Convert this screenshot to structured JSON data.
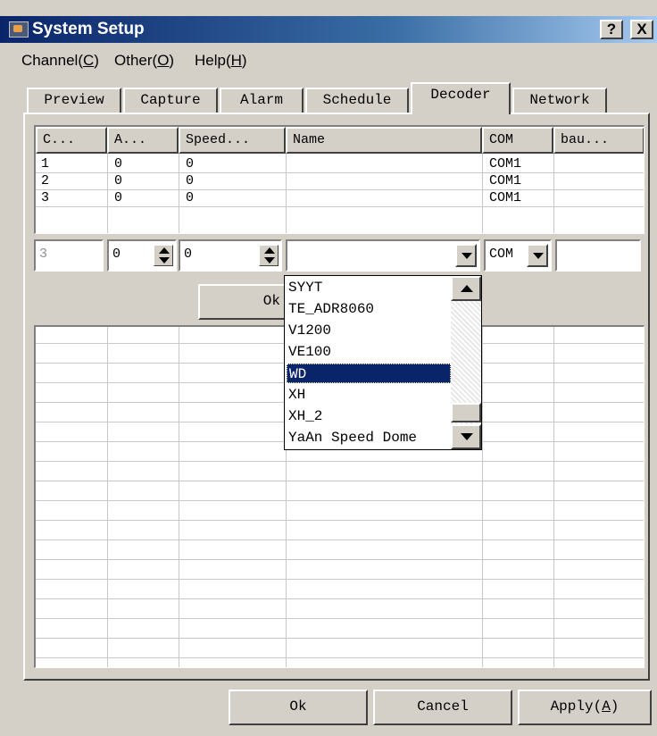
{
  "window": {
    "title": "System Setup",
    "help_btn": "?",
    "close_btn": "X"
  },
  "menu": [
    {
      "pre": "Channel(",
      "key": "C",
      "post": ")"
    },
    {
      "pre": "Other(",
      "key": "O",
      "post": ")"
    },
    {
      "pre": "Help(",
      "key": "H",
      "post": ")"
    }
  ],
  "tabs": [
    "Preview",
    "Capture",
    "Alarm",
    "Schedule",
    "Decoder",
    "Network"
  ],
  "active_tab": "Decoder",
  "list": {
    "columns": [
      "C...",
      "A...",
      "Speed...",
      "Name",
      "COM",
      "bau..."
    ],
    "rows": [
      [
        "1",
        "0",
        "0",
        "",
        "COM1",
        ""
      ],
      [
        "2",
        "0",
        "0",
        "",
        "COM1",
        ""
      ],
      [
        "3",
        "0",
        "0",
        "",
        "COM1",
        ""
      ]
    ]
  },
  "editor": {
    "channel": "3",
    "address": "0",
    "speed": "0",
    "name": "",
    "com": "COM",
    "baud": ""
  },
  "row_ok_label": "Ok",
  "dropdown": {
    "items": [
      "SYYT",
      "TE_ADR8060",
      "V1200",
      "VE100",
      "WD",
      "XH",
      "XH_2",
      "YaAn Speed Dome"
    ],
    "selected": "WD"
  },
  "buttons": {
    "ok": "Ok",
    "cancel": "Cancel",
    "apply_pre": "Apply(",
    "apply_key": "A",
    "apply_post": ")"
  },
  "colors": {
    "face": "#d4d0c8",
    "title_active": "#0a246a",
    "selection": "#0a246a"
  }
}
